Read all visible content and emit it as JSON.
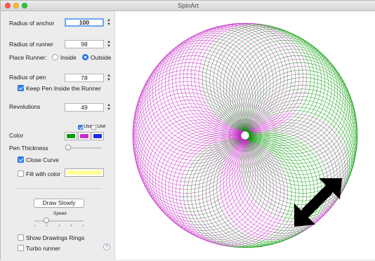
{
  "window": {
    "title": "SpinArt"
  },
  "controls": {
    "anchor_radius": {
      "label": "Radius of anchor",
      "value": "100"
    },
    "runner_radius": {
      "label": "Radius of runner",
      "value": "98"
    },
    "place_runner": {
      "label": "Place Runner:",
      "options": [
        "Inside",
        "Outside"
      ],
      "selected": "Outside"
    },
    "pen_radius": {
      "label": "Radius of pen",
      "value": "78"
    },
    "keep_pen_inside": {
      "label": "Keep Pen Inside the Runner",
      "checked": true
    },
    "revolutions": {
      "label": "Revolutions",
      "value": "49"
    },
    "color": {
      "label": "Color",
      "use_labels": [
        "Use",
        "Use"
      ],
      "use_checked": [
        true,
        false
      ],
      "swatches": [
        "#0c9c0c",
        "#c62ec6",
        "#1a2ee8"
      ]
    },
    "pen_thickness": {
      "label": "Pen Thickness",
      "value": 0.05
    },
    "close_curve": {
      "label": "Close Curve",
      "checked": true
    },
    "fill_with_color": {
      "label": "Fill with color",
      "checked": false,
      "color": "#ffff99"
    },
    "draw_button": {
      "label": "Draw Slowly"
    },
    "speed": {
      "label": "Speed",
      "value": 0.25
    },
    "show_rings": {
      "label": "Show Drawings Rings",
      "checked": false
    },
    "turbo_runner": {
      "label": "Turbo runner",
      "checked": false
    },
    "help": {
      "label": "?"
    }
  },
  "drawing": {
    "colors": {
      "green": "#0c9c0c",
      "magenta": "#c62ec6",
      "arrow": "#000000"
    },
    "resize_icon": "resize-diagonal-arrows-icon"
  }
}
